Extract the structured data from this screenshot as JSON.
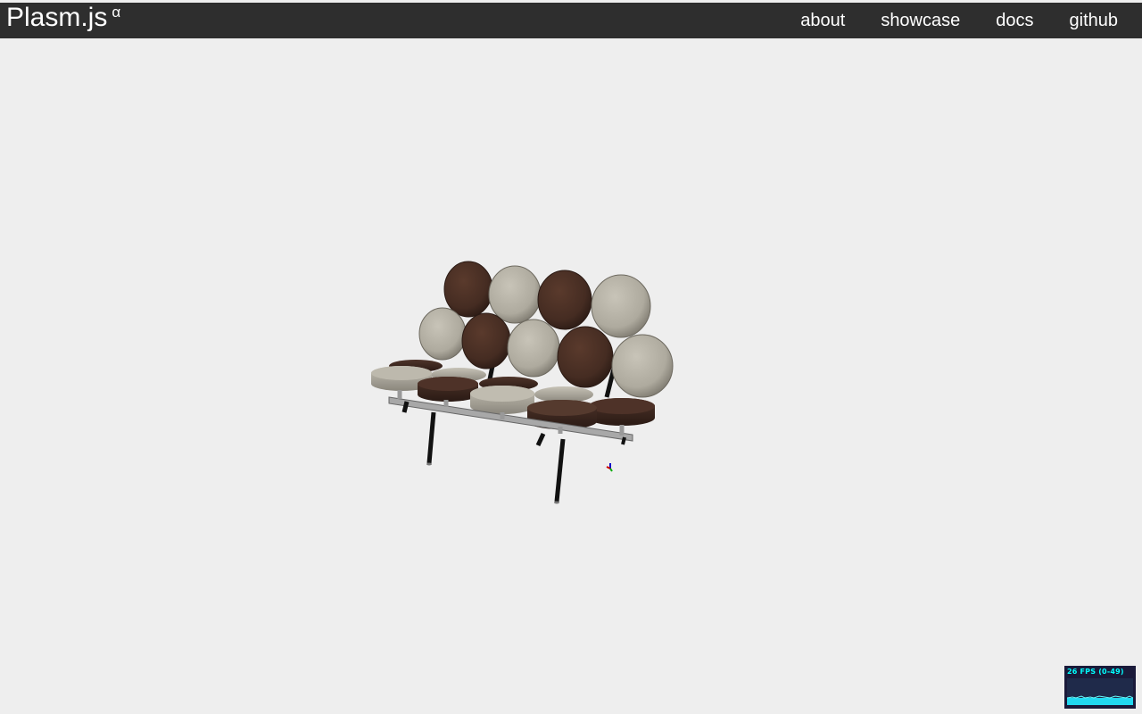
{
  "header": {
    "brand": "Plasm.js",
    "brand_sup": "α",
    "nav": [
      {
        "label": "about"
      },
      {
        "label": "showcase"
      },
      {
        "label": "docs"
      },
      {
        "label": "github"
      }
    ]
  },
  "stats": {
    "fps_label": "26 FPS (0-49)"
  },
  "colors": {
    "header_bg": "#2e2e2e",
    "canvas_bg": "#eeeeee",
    "dark_cushion": "#4a3024",
    "light_cushion": "#b8b4a8",
    "fps_text": "#00ffff"
  }
}
